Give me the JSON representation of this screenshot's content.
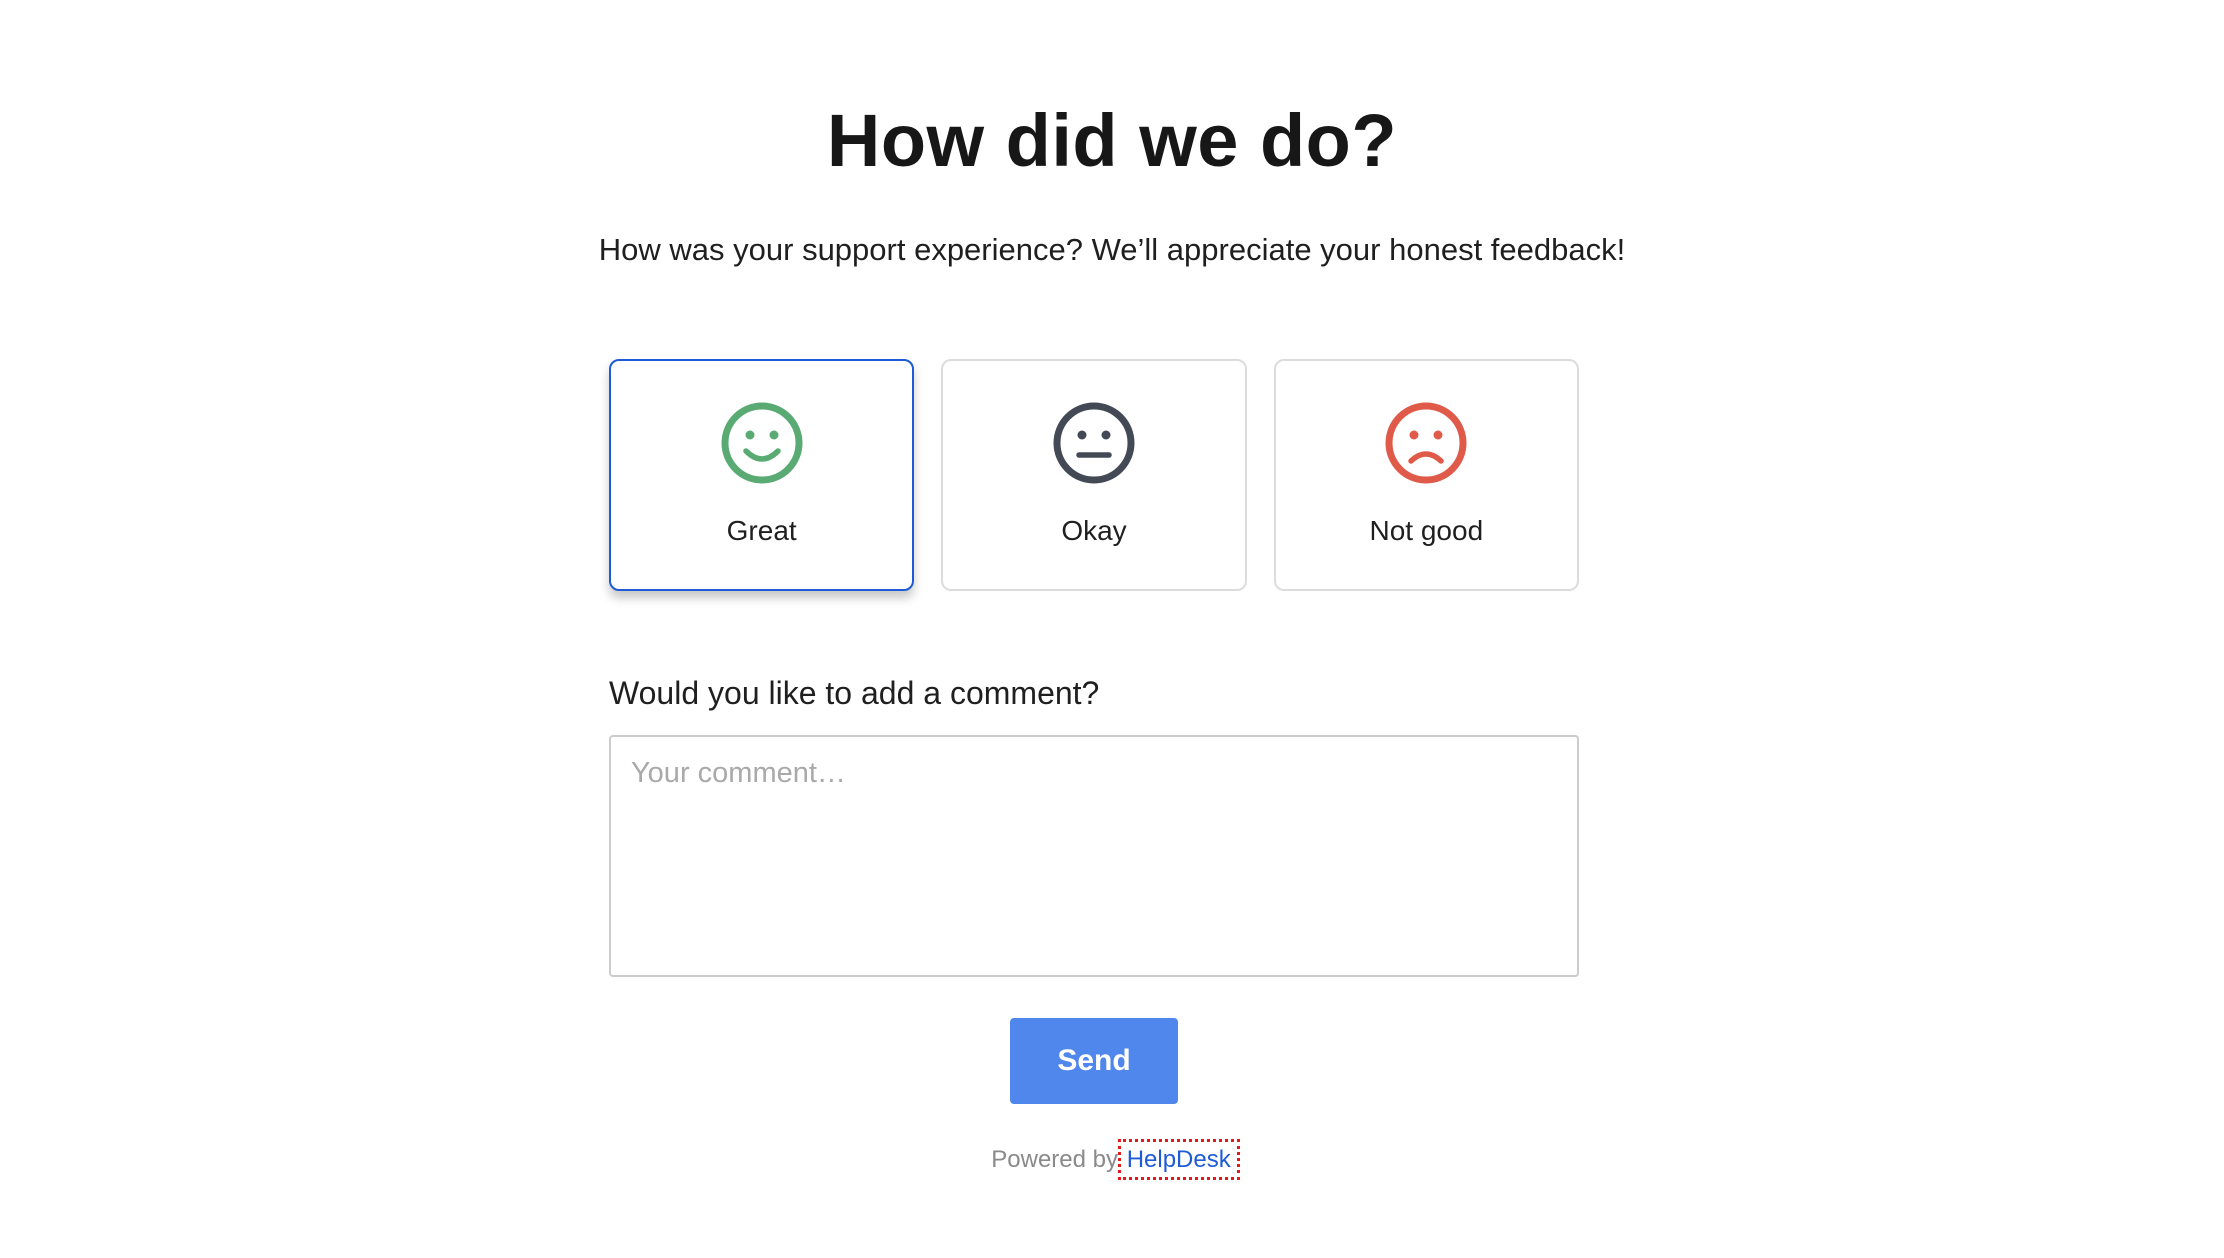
{
  "heading": "How did we do?",
  "subheading": "How was your support experience? We’ll appreciate your honest feedback!",
  "ratings": [
    {
      "label": "Great",
      "icon": "smile-icon",
      "color": "#5aaa74",
      "selected": true
    },
    {
      "label": "Okay",
      "icon": "neutral-face-icon",
      "color": "#434a55",
      "selected": false
    },
    {
      "label": "Not good",
      "icon": "frown-icon",
      "color": "#e05a4a",
      "selected": false
    }
  ],
  "comment": {
    "label": "Would you like to add a comment?",
    "placeholder": "Your comment…",
    "value": ""
  },
  "send_label": "Send",
  "footer": {
    "powered_by": "Powered by",
    "brand": "HelpDesk"
  },
  "colors": {
    "accent": "#4f87ec",
    "selected_border": "#1f5bd6",
    "link": "#1f5bd6"
  }
}
